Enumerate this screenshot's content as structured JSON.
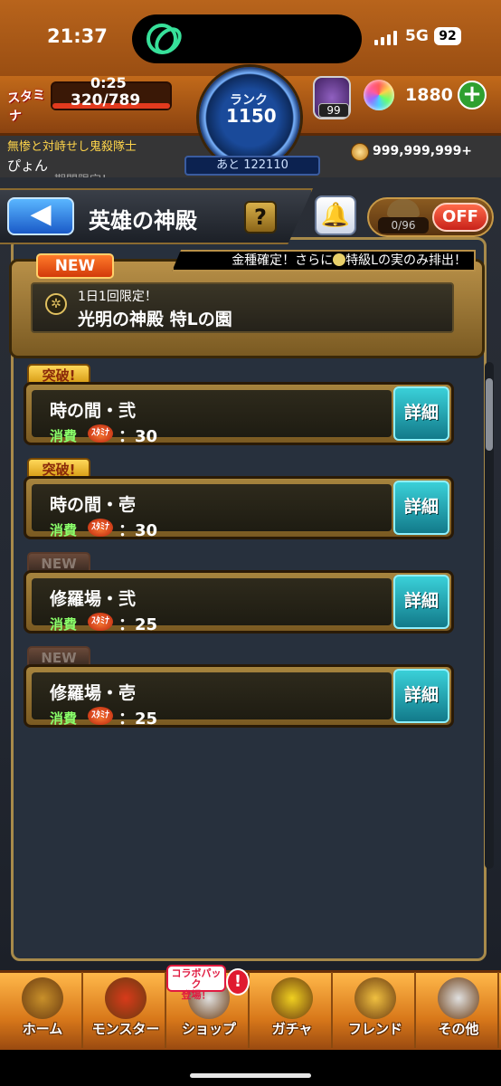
{
  "status_bar": {
    "time": "21:37",
    "network": "5G",
    "battery": "92"
  },
  "hud": {
    "stamina_label": "スタミナ",
    "stamina_timer": "0:25",
    "stamina_value": "320/789",
    "rank_label": "ランク",
    "rank_value": "1150",
    "rank_next": "あと 122110",
    "orb_badge_count": "99",
    "orb_count": "1880",
    "plus": "+",
    "coin_count": "999,999,999+"
  },
  "background": {
    "guild_name": "無惨と対峙せし鬼殺隊士",
    "user_name": "ぴょん",
    "limited_text": "期間限定！"
  },
  "title_bar": {
    "back": "◀",
    "title": "英雄の神殿",
    "help": "?",
    "bell": "🔔",
    "toggle_count": "0/96",
    "toggle_state": "OFF"
  },
  "featured": {
    "new_label": "NEW",
    "note_prefix": "金種確定！さらに",
    "note_suffix": "特級Lの実のみ排出！",
    "small_text": "1日1回限定！",
    "title": "光明の神殿 特Lの園"
  },
  "stages": [
    {
      "tag": "突破!",
      "tag_type": "break",
      "name": "時の間・弐",
      "cost_label": "消費",
      "cost_icon": "ｽﾀﾐﾅ",
      "cost": "：30",
      "detail": "詳細"
    },
    {
      "tag": "突破!",
      "tag_type": "break",
      "name": "時の間・壱",
      "cost_label": "消費",
      "cost_icon": "ｽﾀﾐﾅ",
      "cost": "：30",
      "detail": "詳細"
    },
    {
      "tag": "NEW",
      "tag_type": "new",
      "name": "修羅場・弐",
      "cost_label": "消費",
      "cost_icon": "ｽﾀﾐﾅ",
      "cost": "：25",
      "detail": "詳細"
    },
    {
      "tag": "NEW",
      "tag_type": "new",
      "name": "修羅場・壱",
      "cost_label": "消費",
      "cost_icon": "ｽﾀﾐﾅ",
      "cost": "：25",
      "detail": "詳細"
    }
  ],
  "nav": {
    "items": [
      {
        "label": "ホーム",
        "icon": "home-icon",
        "color": "#c8902a"
      },
      {
        "label": "モンスター",
        "icon": "monster-icon",
        "color": "#d83a1a"
      },
      {
        "label": "ショップ",
        "icon": "shop-icon",
        "color": "#e0e0e0"
      },
      {
        "label": "ガチャ",
        "icon": "gacha-icon",
        "color": "#f0d020"
      },
      {
        "label": "フレンド",
        "icon": "friend-icon",
        "color": "#f0c040"
      },
      {
        "label": "その他",
        "icon": "other-icon",
        "color": "#e0e0e0"
      }
    ],
    "shop_badge": "コラボパック\n登場！",
    "shop_alert": "!"
  }
}
